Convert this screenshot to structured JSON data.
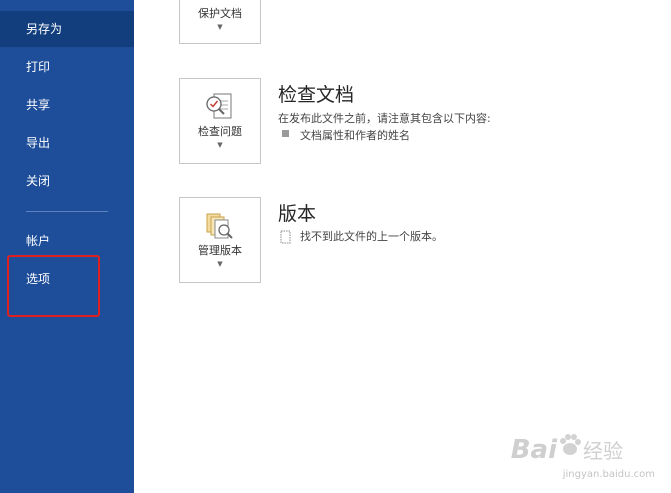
{
  "sidebar": {
    "items": [
      {
        "label": "另存为",
        "active": true
      },
      {
        "label": "打印"
      },
      {
        "label": "共享"
      },
      {
        "label": "导出"
      },
      {
        "label": "关闭"
      },
      {
        "label": "帐户"
      },
      {
        "label": "选项"
      }
    ]
  },
  "sections": {
    "protect": {
      "button_label": "保护文档"
    },
    "inspect": {
      "button_label": "检查问题",
      "title": "检查文档",
      "description": "在发布此文件之前，请注意其包含以下内容:",
      "items": [
        "文档属性和作者的姓名"
      ]
    },
    "versions": {
      "button_label": "管理版本",
      "title": "版本",
      "status": "找不到此文件的上一个版本。"
    }
  },
  "watermark": {
    "logo": "Bai",
    "brand": "经验",
    "url": "jingyan.baidu.com"
  },
  "colors": {
    "sidebar": "#1e4e9a",
    "sidebar_active": "#123e7d",
    "highlight": "#e02020"
  }
}
